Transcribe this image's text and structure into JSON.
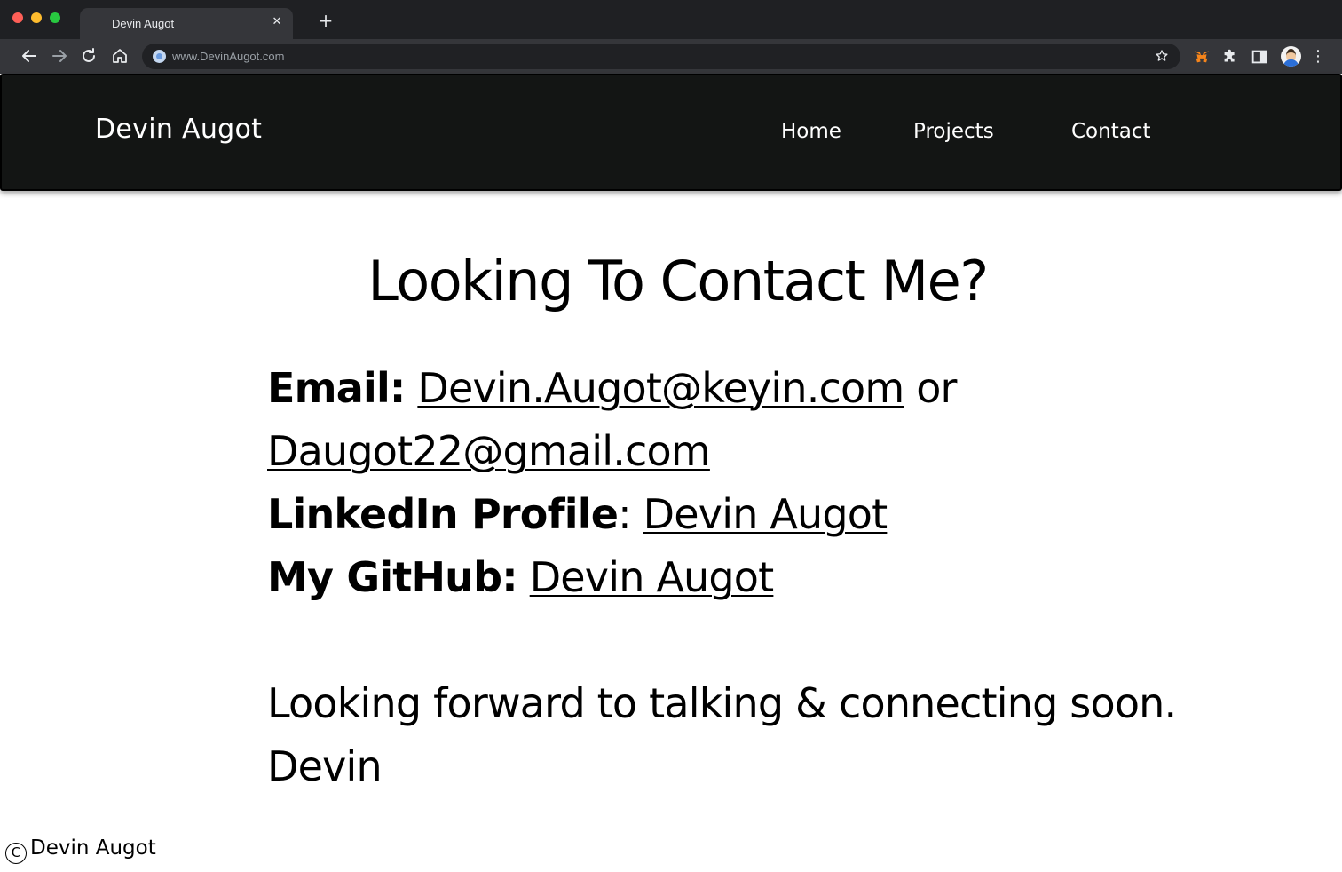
{
  "browser": {
    "tab_title": "Devin Augot",
    "tab_close": "✕",
    "new_tab": "+",
    "url": "www.DevinAugot.com",
    "menu": "⋮"
  },
  "nav": {
    "brand": "Devin Augot",
    "links": [
      {
        "label": "Home"
      },
      {
        "label": "Projects"
      },
      {
        "label": "Contact"
      }
    ]
  },
  "heading": "Looking To Contact Me?",
  "contact": {
    "email_label": "Email:",
    "email_primary": "Devin.Augot@keyin.com",
    "or": "or",
    "email_secondary": "Daugot22@gmail.com",
    "linkedin_label": "LinkedIn Profile",
    "linkedin_colon": ":",
    "linkedin_link": "Devin Augot",
    "github_label": "My GitHub:",
    "github_link": "Devin Augot",
    "closing": "Looking forward to talking & connecting soon.",
    "signature": "Devin"
  },
  "footer": {
    "copyright_symbol": "C",
    "name": "Devin Augot"
  }
}
